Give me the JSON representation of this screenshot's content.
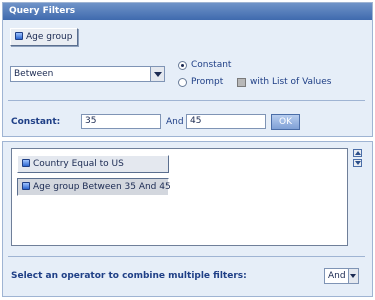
{
  "panel": {
    "title": "Query Filters"
  },
  "object_button": {
    "label": "Age group",
    "icon": "dimension-icon"
  },
  "operator": {
    "selected": "Between"
  },
  "operand_mode": {
    "constant_label": "Constant",
    "prompt_label": "Prompt",
    "selected": "Constant",
    "list_values_label": "with List of Values",
    "list_values_checked": false
  },
  "constant": {
    "label": "Constant:",
    "value_from": "35",
    "and_label": "And",
    "value_to": "45",
    "ok_label": "OK"
  },
  "filters": {
    "items": [
      {
        "label": "Country Equal to US",
        "selected": false
      },
      {
        "label": "Age group Between 35 And 45",
        "selected": true
      }
    ]
  },
  "combine": {
    "label": "Select an operator to combine multiple filters:",
    "selected": "And"
  },
  "colors": {
    "panel_bg": "#e6eef8",
    "title_bar": "#3f6aae",
    "label_blue": "#1f3f86"
  }
}
